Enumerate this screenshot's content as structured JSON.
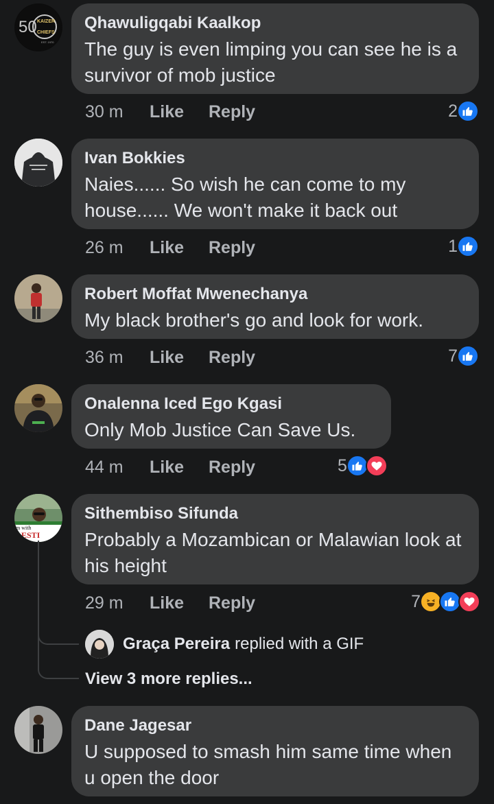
{
  "comments": [
    {
      "name": "Qhawuligqabi Kaalkop",
      "text": "The guy is even limping you can see he is a survivor of mob justice",
      "time": "30 m",
      "like": "Like",
      "reply": "Reply",
      "reaction_count": "2",
      "reactions": [
        "like"
      ],
      "avatar": {
        "type": "logo",
        "lines": [
          "KAIZER",
          "CHIEFS"
        ],
        "digit": "50",
        "color": "#101010"
      }
    },
    {
      "name": "Ivan Bokkies",
      "text": "Naies...... So wish he can come to my house...... We won't make it back out",
      "time": "26 m",
      "like": "Like",
      "reply": "Reply",
      "reaction_count": "1",
      "reactions": [
        "like"
      ],
      "avatar": {
        "type": "hoodie",
        "color": "#2b2c2e"
      }
    },
    {
      "name": "Robert Moffat Mwenechanya",
      "text": "My black brother's  go and look for work.",
      "time": "36 m",
      "like": "Like",
      "reply": "Reply",
      "reaction_count": "7",
      "reactions": [
        "like"
      ],
      "avatar": {
        "type": "person",
        "color": "#b7a98f",
        "shirt": "#c0302f"
      }
    },
    {
      "name": "Onalenna Iced Ego Kgasi",
      "text": "Only Mob Justice Can Save Us.",
      "time": "44 m",
      "like": "Like",
      "reply": "Reply",
      "reaction_count": "5",
      "reactions": [
        "like",
        "love"
      ],
      "avatar": {
        "type": "person",
        "color": "#7a6a4b",
        "shirt": "#1e1f22"
      }
    },
    {
      "name": "Sithembiso Sifunda",
      "text": "Probably a Mozambican or Malawian look at his height",
      "time": "29 m",
      "like": "Like",
      "reply": "Reply",
      "reaction_count": "7",
      "reactions": [
        "haha",
        "like",
        "love"
      ],
      "avatar": {
        "type": "banner",
        "lines": [
          "m with",
          "LESTI"
        ],
        "color": "#6e8f6a"
      },
      "reply_preview": {
        "name": "Graça Pereira",
        "text": "replied with a GIF"
      },
      "view_more": "View 3 more replies..."
    },
    {
      "name": "Dane Jagesar",
      "text": "U supposed to smash him same time when u open the door",
      "avatar": {
        "type": "person",
        "color": "#9a9a98",
        "shirt": "#151515"
      }
    }
  ],
  "colors": {
    "background": "#18191a",
    "bubble": "#3a3b3c",
    "like_blue": "#1877f2",
    "love_red": "#f33e58",
    "haha_yellow": "#f7b125"
  }
}
